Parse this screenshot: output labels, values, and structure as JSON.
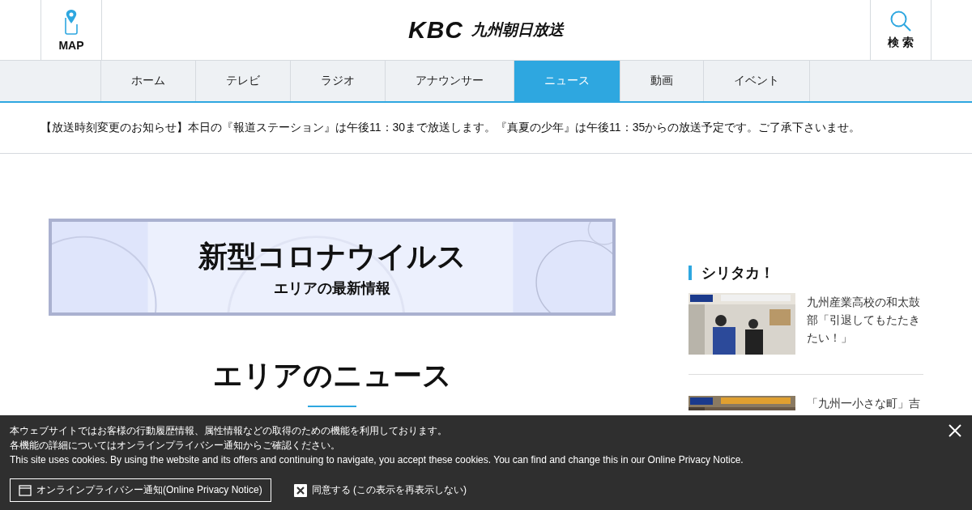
{
  "header": {
    "map_label": "MAP",
    "logo_mark": "KBC",
    "logo_name": "九州朝日放送",
    "search_label": "検 索"
  },
  "nav": [
    {
      "label": "ホーム",
      "selected": false
    },
    {
      "label": "テレビ",
      "selected": false
    },
    {
      "label": "ラジオ",
      "selected": false
    },
    {
      "label": "アナウンサー",
      "selected": false
    },
    {
      "label": "ニュース",
      "selected": true
    },
    {
      "label": "動画",
      "selected": false
    },
    {
      "label": "イベント",
      "selected": false
    }
  ],
  "notice": "【放送時刻変更のお知らせ】本日の『報道ステーション』は午後11：30まで放送します。『真夏の少年』は午後11：35からの放送予定です。ご了承下さいませ。",
  "banner": {
    "title": "新型コロナウイルス",
    "subtitle": "エリアの最新情報"
  },
  "section_title": "エリアのニュース",
  "sidebar": {
    "title": "シリタカ！",
    "items": [
      {
        "title": "九州産業高校の和太鼓部「引退してもたたきたい！」"
      },
      {
        "title": "「九州一小さな町」吉"
      }
    ]
  },
  "cookie_banner": {
    "lines": [
      "本ウェブサイトではお客様の行動履歴情報、属性情報などの取得のための機能を利用しております。",
      "各機能の詳細についてはオンラインプライバシー通知からご確認ください。",
      "This site uses cookies. By using the website and its offers and continuing to navigate, you accept these cookies. You can find and change this in our Online Privacy Notice."
    ],
    "privacy_button": "オンラインプライバシー通知(Online Privacy Notice)",
    "agree_button": "同意する (この表示を再表示しない)"
  }
}
